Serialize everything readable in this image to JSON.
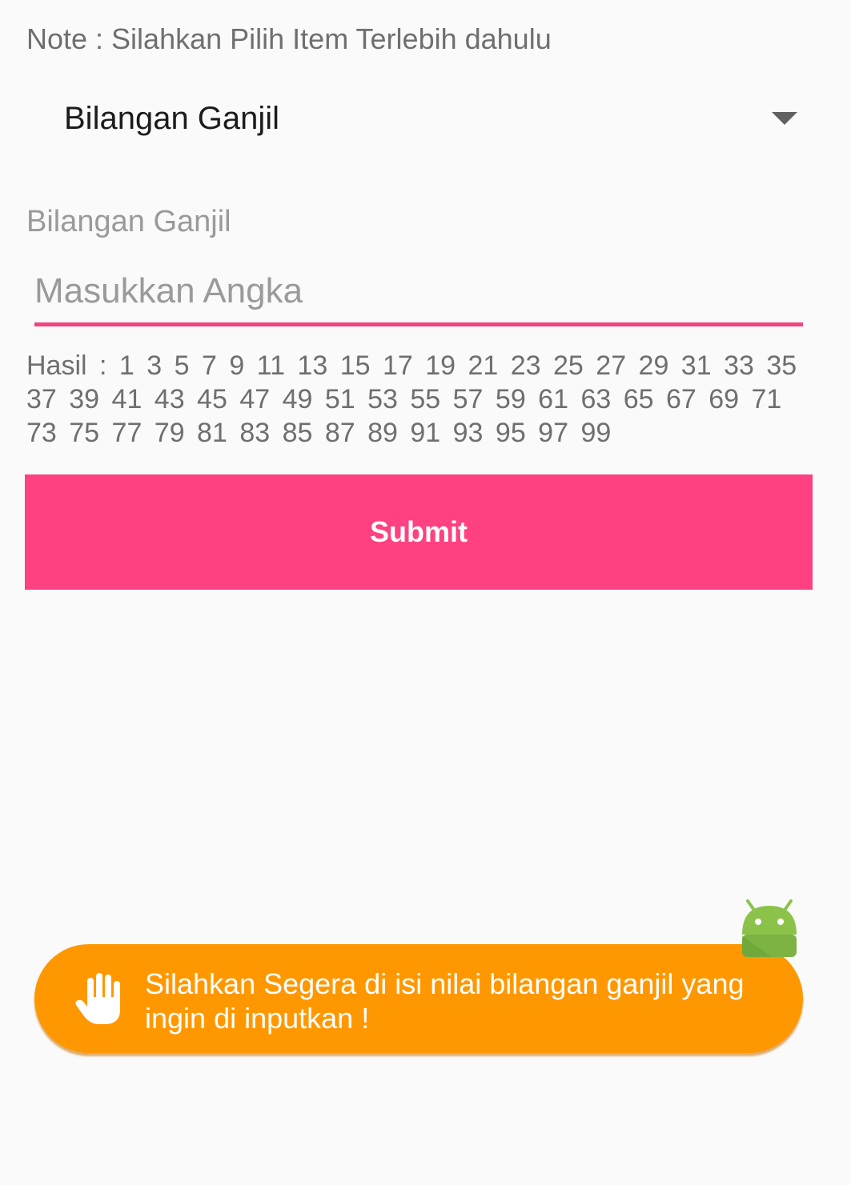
{
  "note": "Note : Silahkan Pilih Item Terlebih dahulu",
  "spinner": {
    "selected": "Bilangan Ganjil",
    "icon": "dropdown-arrow-icon"
  },
  "section_label": "Bilangan Ganjil",
  "input": {
    "value": "",
    "placeholder": "Masukkan Angka"
  },
  "result_text": "Hasil :  1  3  5  7  9  11  13  15  17  19  21  23  25  27  29  31  33  35  37  39  41  43  45  47  49  51  53  55  57  59  61  63  65  67  69  71  73  75  77  79  81  83  85  87  89  91  93  95  97  99",
  "submit_label": "Submit",
  "toast": {
    "message": "Silahkan Segera di isi nilai bilangan ganjil yang ingin di inputkan !",
    "icon": "hand-stop-icon",
    "badge_icon": "android-icon"
  },
  "colors": {
    "accent": "#ff4081",
    "underline": "#f0457e",
    "toast_bg": "#ff9800",
    "android_green": "#8bc34a",
    "background": "#fafafa"
  }
}
